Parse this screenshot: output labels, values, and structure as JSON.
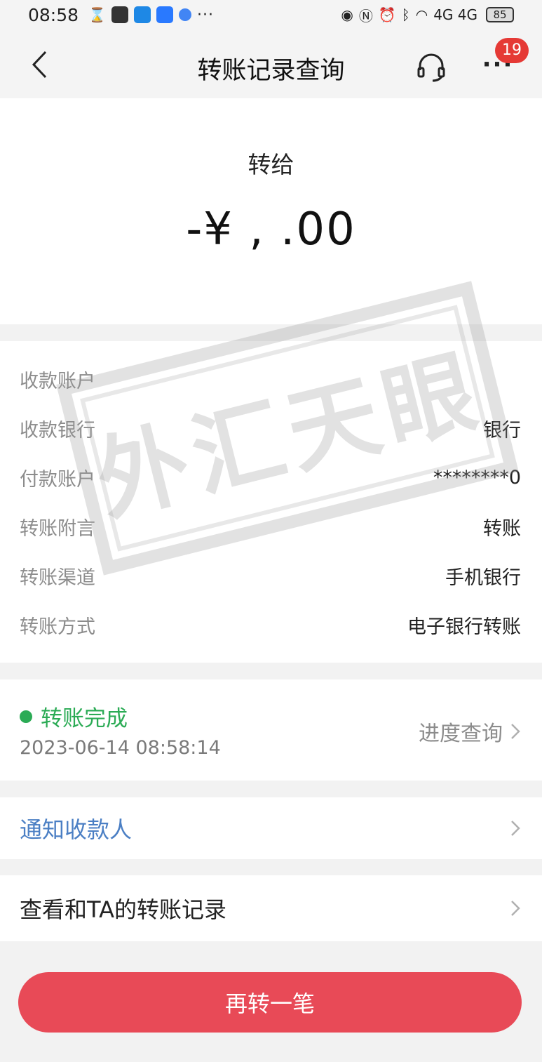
{
  "status_bar": {
    "time": "08:58",
    "right_text": "4G 4G",
    "battery": "85",
    "more": "···"
  },
  "nav": {
    "title": "转账记录查询",
    "more": "···",
    "badge": "19"
  },
  "summary": {
    "recipient": "转给",
    "amount": "-¥ ,   .00"
  },
  "details": {
    "rows": [
      {
        "label": "收款账户",
        "value": ""
      },
      {
        "label": "收款银行",
        "value": "银行"
      },
      {
        "label": "付款账户",
        "value": "********0"
      },
      {
        "label": "转账附言",
        "value": "转账"
      },
      {
        "label": "转账渠道",
        "value": "手机银行"
      },
      {
        "label": "转账方式",
        "value": "电子银行转账"
      }
    ]
  },
  "status": {
    "label": "转账完成",
    "time": "2023-06-14 08:58:14",
    "progress_link": "进度查询"
  },
  "actions": {
    "notify": "通知收款人",
    "history": "查看和TA的转账记录",
    "again": "再转一笔"
  },
  "watermark": {
    "text": "外汇天眼"
  },
  "colors": {
    "accent_red": "#e84a57",
    "success_green": "#2bab55",
    "link_blue": "#4b7fc4",
    "badge_red": "#e53935"
  },
  "icons": {
    "back": "chevron-left-icon",
    "service": "headset-icon",
    "chevron": "chevron-right-icon"
  }
}
